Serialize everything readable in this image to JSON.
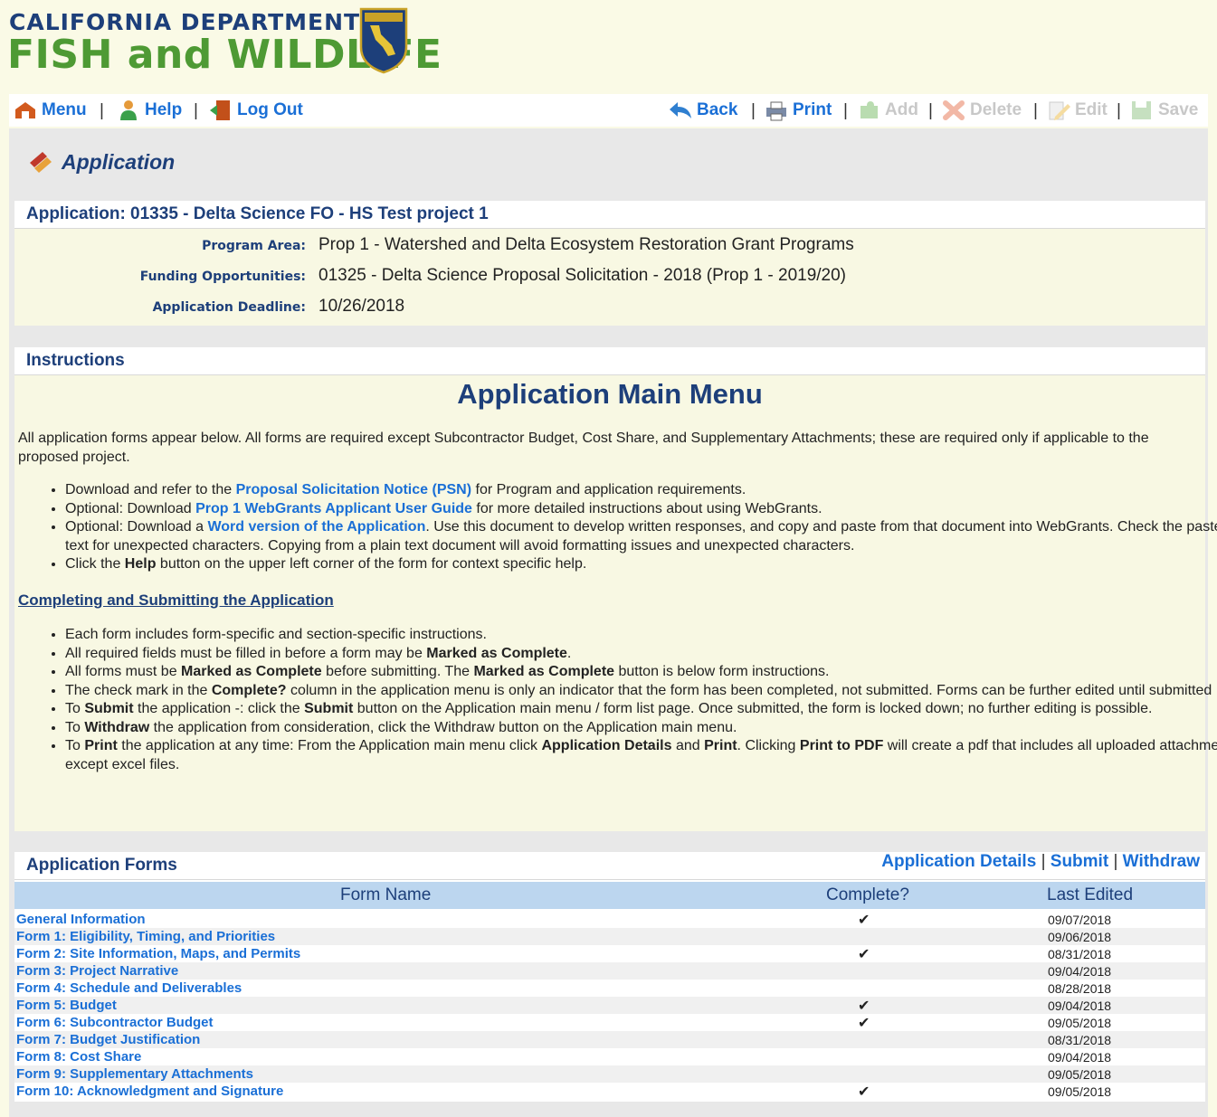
{
  "header": {
    "logo_line1": "CALIFORNIA DEPARTMENT OF",
    "logo_line2": "FISH and WILDLIFE",
    "badge_text": "CALIFORNIA FISH & WILDLIFE"
  },
  "toolbar": {
    "menu": "Menu",
    "help": "Help",
    "logout": "Log Out",
    "back": "Back",
    "print": "Print",
    "add": "Add",
    "delete": "Delete",
    "edit": "Edit",
    "save": "Save",
    "sep": "|"
  },
  "page_title": "Application",
  "application": {
    "heading": "Application: 01335 - Delta Science FO - HS Test project 1",
    "program_area_label": "Program Area:",
    "program_area": "Prop 1 - Watershed and Delta Ecosystem Restoration Grant Programs",
    "funding_label": "Funding Opportunities:",
    "funding": "01325 - Delta Science Proposal Solicitation - 2018 (Prop 1 - 2019/20)",
    "deadline_label": "Application Deadline:",
    "deadline": "10/26/2018"
  },
  "instructions": {
    "heading": "Instructions",
    "title": "Application Main Menu",
    "intro": "All application forms appear below. All forms are required except Subcontractor Budget, Cost Share, and Supplementary Attachments; these are required only if applicable to the proposed project.",
    "b1_pre": "Download and refer to the ",
    "b1_link": "Proposal Solicitation Notice (PSN)",
    "b1_post": " for Program and application requirements.",
    "b2_pre": "Optional: Download ",
    "b2_link": "Prop 1 WebGrants Applicant User Guide",
    "b2_post": " for more detailed instructions about using WebGrants.",
    "b3_pre": "Optional: Download a ",
    "b3_link": "Word version of the Application",
    "b3_post": ". Use this document to develop written responses, and copy and paste from that document into WebGrants. Check the pasted text for unexpected characters. Copying from a plain text document will avoid formatting issues and unexpected characters.",
    "b4_pre": "Click the ",
    "b4_bold": "Help",
    "b4_post": " button on the upper left corner of the form for context specific help.",
    "cs_heading": "Completing and Submitting the Application",
    "c1": "Each form includes form-specific and section-specific instructions.",
    "c2_pre": "All required fields must be filled in before a form may be ",
    "c2_bold": "Marked as Complete",
    "c2_post": ".",
    "c3_pre": "All forms must be ",
    "c3_bold": "Marked as Complete",
    "c3_mid": " before submitting. The ",
    "c3_bold2": "Marked as Complete",
    "c3_post": " button is below form instructions.",
    "c4_pre": "The check mark in the ",
    "c4_bold": "Complete?",
    "c4_post": " column in the application menu is only an indicator that the form has been completed, not submitted. Forms can be further edited until submitted",
    "c5_pre": "To ",
    "c5_bold": "Submit",
    "c5_mid": " the application -: click the ",
    "c5_bold2": "Submit",
    "c5_post": " button on the Application main menu / form list page. Once submitted, the form is locked down; no further editing is possible.",
    "c6_pre": "To ",
    "c6_bold": "Withdraw",
    "c6_post": " the application from consideration, click the Withdraw button on the Application main menu.",
    "c7_pre": "To ",
    "c7_bold": "Print",
    "c7_mid": " the application at any time: From the Application main menu click ",
    "c7_bold2": "Application Details",
    "c7_and": " and ",
    "c7_bold3": "Print",
    "c7_mid2": ". Clicking ",
    "c7_bold4": "Print to PDF",
    "c7_post": " will create a pdf that includes all uploaded attachments except excel files."
  },
  "forms": {
    "heading": "Application Forms",
    "details_link": "Application Details",
    "submit_link": "Submit",
    "withdraw_link": "Withdraw",
    "sep": "|",
    "col_name": "Form Name",
    "col_complete": "Complete?",
    "col_edited": "Last Edited",
    "rows": [
      {
        "name": "General Information",
        "complete": "✔",
        "date": "09/07/2018"
      },
      {
        "name": "Form 1: Eligibility, Timing, and Priorities",
        "complete": "",
        "date": "09/06/2018"
      },
      {
        "name": "Form 2: Site Information, Maps, and Permits",
        "complete": "✔",
        "date": "08/31/2018"
      },
      {
        "name": "Form 3: Project Narrative",
        "complete": "",
        "date": "09/04/2018"
      },
      {
        "name": "Form 4: Schedule and Deliverables",
        "complete": "",
        "date": "08/28/2018"
      },
      {
        "name": "Form 5: Budget",
        "complete": "✔",
        "date": "09/04/2018"
      },
      {
        "name": "Form 6: Subcontractor Budget",
        "complete": "✔",
        "date": "09/05/2018"
      },
      {
        "name": "Form 7: Budget Justification",
        "complete": "",
        "date": "08/31/2018"
      },
      {
        "name": "Form 8: Cost Share",
        "complete": "",
        "date": "09/04/2018"
      },
      {
        "name": "Form 9: Supplementary Attachments",
        "complete": "",
        "date": "09/05/2018"
      },
      {
        "name": "Form 10: Acknowledgment and Signature",
        "complete": "✔",
        "date": "09/05/2018"
      }
    ]
  },
  "colors": {
    "link": "#1a6fd6",
    "navy": "#1d3f7a",
    "logo_green": "#4e9a34",
    "panel_bg": "#f8f8e3",
    "table_header_bg": "#bcd6ef"
  }
}
